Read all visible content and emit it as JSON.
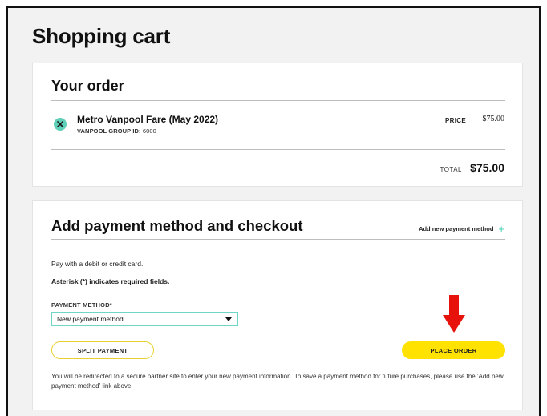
{
  "page": {
    "title": "Shopping cart"
  },
  "order": {
    "heading": "Your order",
    "item": {
      "name": "Metro Vanpool Fare (May 2022)",
      "group_id_label": "VANPOOL GROUP ID:",
      "group_id_value": "6000",
      "price_label": "PRICE",
      "price": "$75.00"
    },
    "total_label": "TOTAL",
    "total": "$75.00"
  },
  "payment": {
    "heading": "Add payment method and checkout",
    "add_link_label": "Add new payment method",
    "add_link_icon": "plus-icon",
    "intro_text": "Pay with a debit or credit card.",
    "required_note": "Asterisk (*) indicates required fields.",
    "method_label": "PAYMENT METHOD*",
    "method_selected": "New payment method",
    "split_button": "SPLIT PAYMENT",
    "place_order_button": "PLACE ORDER",
    "redirect_note": "You will be redirected to a secure partner site to enter your new payment information. To save a payment method for future purchases, please use the 'Add new payment method' link above."
  },
  "colors": {
    "accent": "#5fcfb8",
    "place_order": "#ffe200",
    "split_border": "#e7cf2e",
    "annotation_arrow": "#e8120c"
  },
  "icons": {
    "remove": "close-circle-icon",
    "select_caret": "caret-down-icon",
    "annotation": "red-arrow-down-icon"
  }
}
